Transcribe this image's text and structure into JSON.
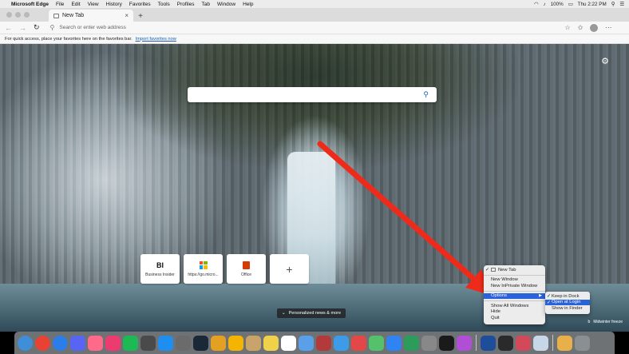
{
  "menubar": {
    "app_name": "Microsoft Edge",
    "items": [
      "File",
      "Edit",
      "View",
      "History",
      "Favorites",
      "Tools",
      "Profiles",
      "Tab",
      "Window",
      "Help"
    ],
    "battery": "100%",
    "clock": "Thu 2:22 PM"
  },
  "tab": {
    "title": "New Tab",
    "close": "×",
    "new_tab": "+"
  },
  "toolbar": {
    "address_placeholder": "Search or enter web address"
  },
  "favbar": {
    "prompt": "For quick access, place your favorites here on the favorites bar.",
    "import_link": "Import favorites now"
  },
  "ntp": {
    "tiles": [
      {
        "logo": "BI",
        "label": "Business Insider"
      },
      {
        "logo": "",
        "label": "https://go.micro..."
      },
      {
        "logo": "",
        "label": "Office"
      },
      {
        "logo": "+",
        "label": ""
      }
    ],
    "news_button": "Personalized news & more",
    "image_credit": "Midwinter freeze"
  },
  "context_menu": {
    "items": [
      "New Tab",
      "New Window",
      "New InPrivate Window",
      "Options",
      "Show All Windows",
      "Hide",
      "Quit"
    ],
    "options_submenu": [
      "Keep in Dock",
      "Open at Login",
      "Show in Finder"
    ]
  },
  "dock": {
    "colors": [
      "#3f8ed8",
      "#e94235",
      "#2b7de9",
      "#5865f2",
      "#ff6a8a",
      "#ec3b6f",
      "#1db954",
      "#4a4a4a",
      "#1f8ef1",
      "#6b6b6b",
      "#1b2838",
      "#e4a020",
      "#f4b400",
      "#c9a46a",
      "#f0d24a",
      "#ffffff",
      "#5aa0e8",
      "#b23a3a",
      "#3d9be9",
      "#e34747",
      "#56c16b",
      "#2f83f3",
      "#2b9c5a",
      "#888888",
      "#1a1a1a",
      "#b04fd6",
      "#1e4d9a",
      "#2a2a2a",
      "#d24a5a",
      "#c8d7e8",
      "#e8b04a",
      "#8a8f94"
    ]
  }
}
